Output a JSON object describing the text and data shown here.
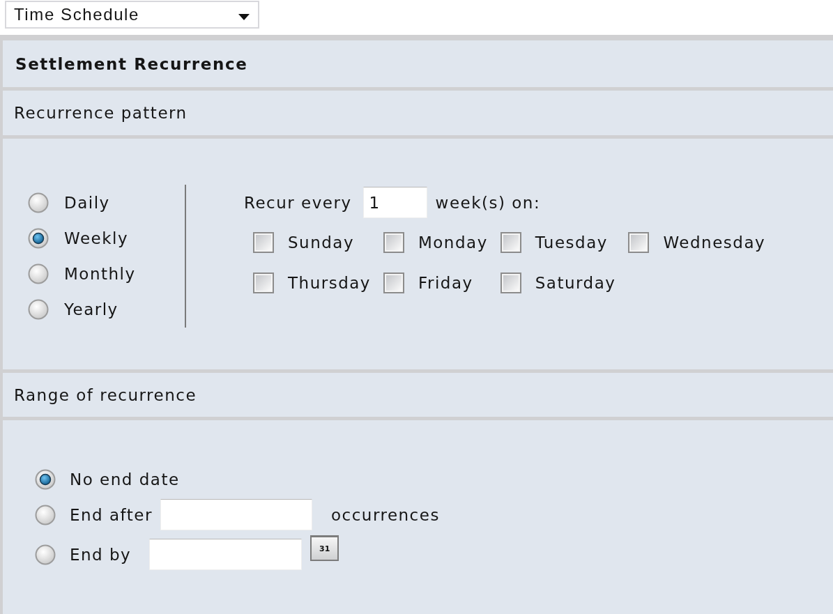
{
  "schedule_select": {
    "value": "Time Schedule"
  },
  "settlement": {
    "title": "Settlement Recurrence"
  },
  "pattern": {
    "heading": "Recurrence pattern",
    "options": [
      {
        "label": "Daily",
        "selected": false
      },
      {
        "label": "Weekly",
        "selected": true
      },
      {
        "label": "Monthly",
        "selected": false
      },
      {
        "label": "Yearly",
        "selected": false
      }
    ],
    "recur_label": "Recur every",
    "interval": "1",
    "unit_label": "week(s) on:",
    "days": [
      {
        "label": "Sunday",
        "checked": false
      },
      {
        "label": "Monday",
        "checked": false
      },
      {
        "label": "Tuesday",
        "checked": false
      },
      {
        "label": "Wednesday",
        "checked": false
      },
      {
        "label": "Thursday",
        "checked": false
      },
      {
        "label": "Friday",
        "checked": false
      },
      {
        "label": "Saturday",
        "checked": false
      }
    ]
  },
  "range": {
    "heading": "Range of recurrence",
    "options": [
      {
        "kind": "no_end",
        "label": "No end date",
        "selected": true
      },
      {
        "kind": "count",
        "label": "End after",
        "selected": false,
        "suffix": "occurrences"
      },
      {
        "kind": "date",
        "label": "End by",
        "selected": false,
        "calendar_label": "31"
      }
    ]
  }
}
